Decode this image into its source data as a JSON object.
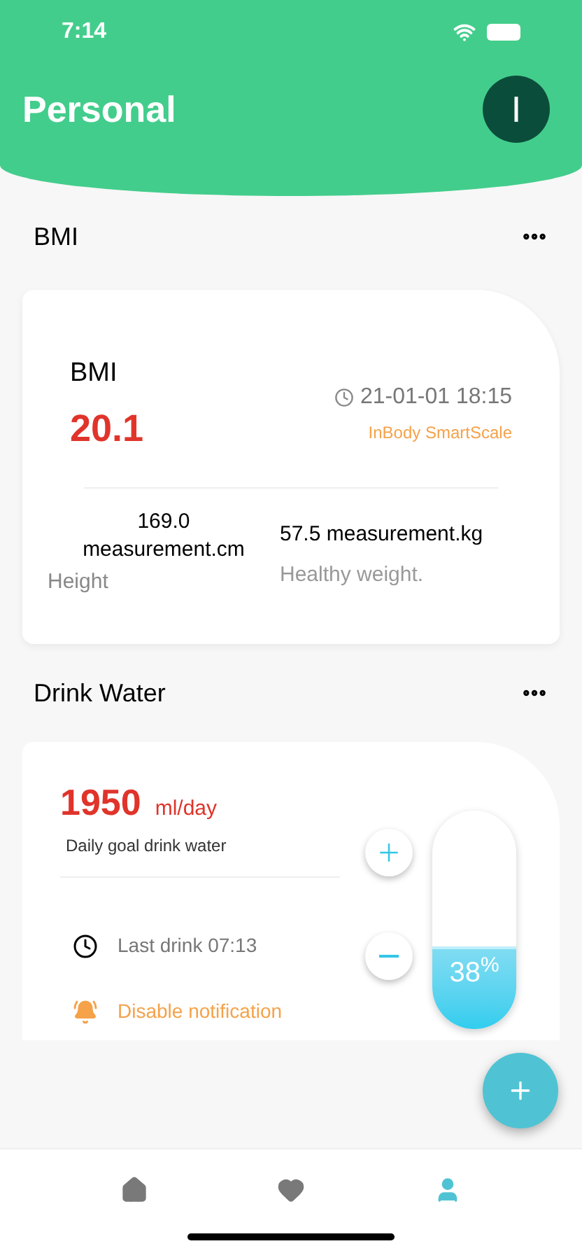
{
  "status_bar": {
    "time": "7:14"
  },
  "header": {
    "title": "Personal",
    "avatar_letter": "I"
  },
  "bmi_section": {
    "title": "BMI",
    "card": {
      "label": "BMI",
      "value": "20.1",
      "datetime": "21-01-01 18:15",
      "source": "InBody SmartScale",
      "height_value": "169.0 measurement.cm",
      "height_label": "Height",
      "weight_value": "57.5 measurement.kg",
      "weight_label": "Healthy weight."
    }
  },
  "water_section": {
    "title": "Drink Water",
    "card": {
      "goal_value": "1950",
      "goal_unit": "ml/day",
      "goal_label": "Daily goal drink water",
      "last_drink": "Last drink 07:13",
      "notification": "Disable notification",
      "level": 0.38,
      "percent": "38$^{%}$"
    }
  },
  "bottom_nav": [
    {
      "kind": "home",
      "selected": false
    },
    {
      "kind": "heart",
      "selected": false
    },
    {
      "kind": "person",
      "selected": true
    }
  ]
}
